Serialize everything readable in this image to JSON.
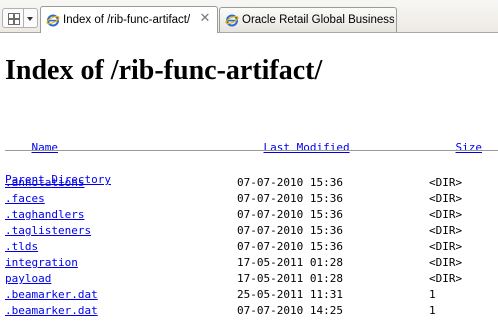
{
  "browser": {
    "tabs": [
      {
        "title": "Index of /rib-func-artifact/",
        "active": true
      },
      {
        "title": "Oracle Retail Global Business ...",
        "active": false
      }
    ],
    "close_glyph": "✕"
  },
  "page": {
    "heading": "Index of /rib-func-artifact/",
    "columns": {
      "name": "Name",
      "modified": "Last Modified",
      "size": "Size"
    },
    "parent": "Parent Directory",
    "rows": [
      {
        "name": ".annotations",
        "modified": "07-07-2010 15:36",
        "size": "<DIR>"
      },
      {
        "name": ".faces",
        "modified": "07-07-2010 15:36",
        "size": "<DIR>"
      },
      {
        "name": ".taghandlers",
        "modified": "07-07-2010 15:36",
        "size": "<DIR>"
      },
      {
        "name": ".taglisteners",
        "modified": "07-07-2010 15:36",
        "size": "<DIR>"
      },
      {
        "name": ".tlds",
        "modified": "07-07-2010 15:36",
        "size": "<DIR>"
      },
      {
        "name": "integration",
        "modified": "17-05-2011 01:28",
        "size": "<DIR>"
      },
      {
        "name": "payload",
        "modified": "17-05-2011 01:28",
        "size": "<DIR>"
      },
      {
        "name": ".beamarker.dat",
        "modified": "25-05-2011 11:31",
        "size": "1"
      },
      {
        "name": ".beamarker.dat",
        "modified": "07-07-2010 14:25",
        "size": "1"
      }
    ]
  },
  "colors": {
    "link": "#0000ee",
    "tab_border": "#9b9b9b"
  }
}
